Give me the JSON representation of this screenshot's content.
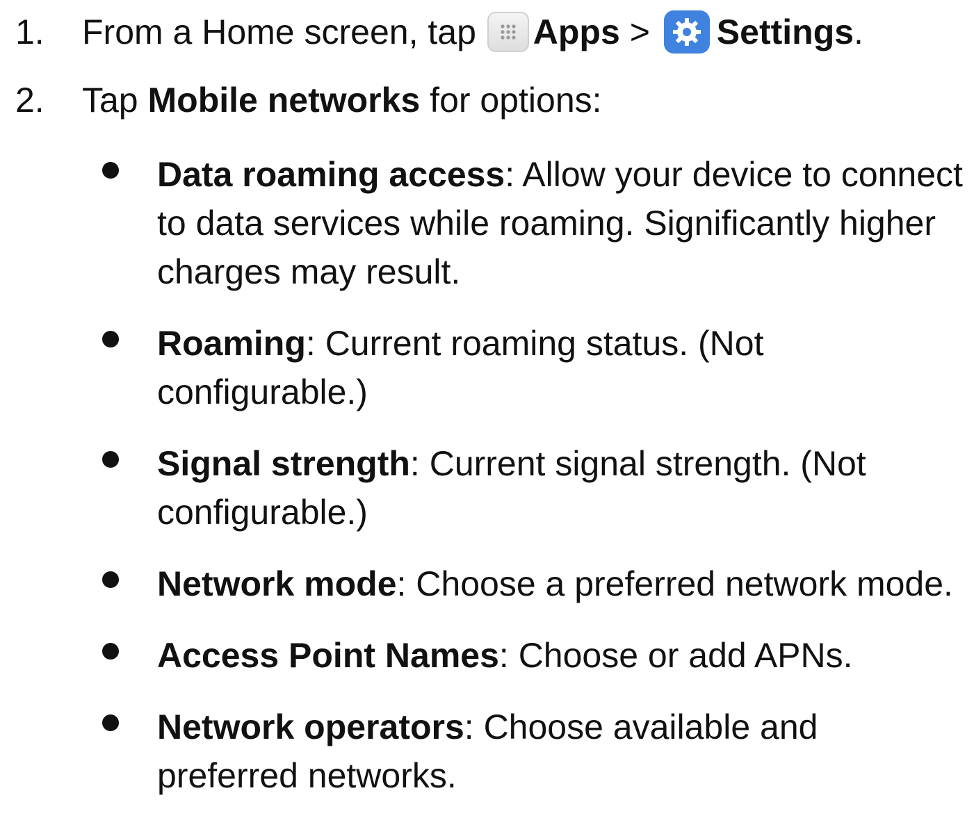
{
  "steps": [
    {
      "number": "1.",
      "text_before": "From a Home screen, tap",
      "apps_label": "Apps",
      "separator": ">",
      "settings_label": "Settings",
      "end": ".",
      "apps_icon": "apps-grid-icon",
      "settings_icon": "settings-gear-icon",
      "settings_icon_color": "#3f82e0"
    },
    {
      "number": "2.",
      "text_before": "Tap",
      "bold": "Mobile networks",
      "text_after": "for options:"
    }
  ],
  "options": [
    {
      "term": "Data roaming access",
      "description": ": Allow your device to connect to data services while roaming. Significantly higher charges may result."
    },
    {
      "term": "Roaming",
      "description": ": Current roaming status. (Not configurable.)"
    },
    {
      "term": "Signal strength",
      "description": ": Current signal strength. (Not configurable.)"
    },
    {
      "term": "Network mode",
      "description": ": Choose a preferred network mode."
    },
    {
      "term": "Access Point Names",
      "description": ": Choose or add APNs."
    },
    {
      "term": "Network operators",
      "description": ": Choose available and preferred networks."
    }
  ]
}
